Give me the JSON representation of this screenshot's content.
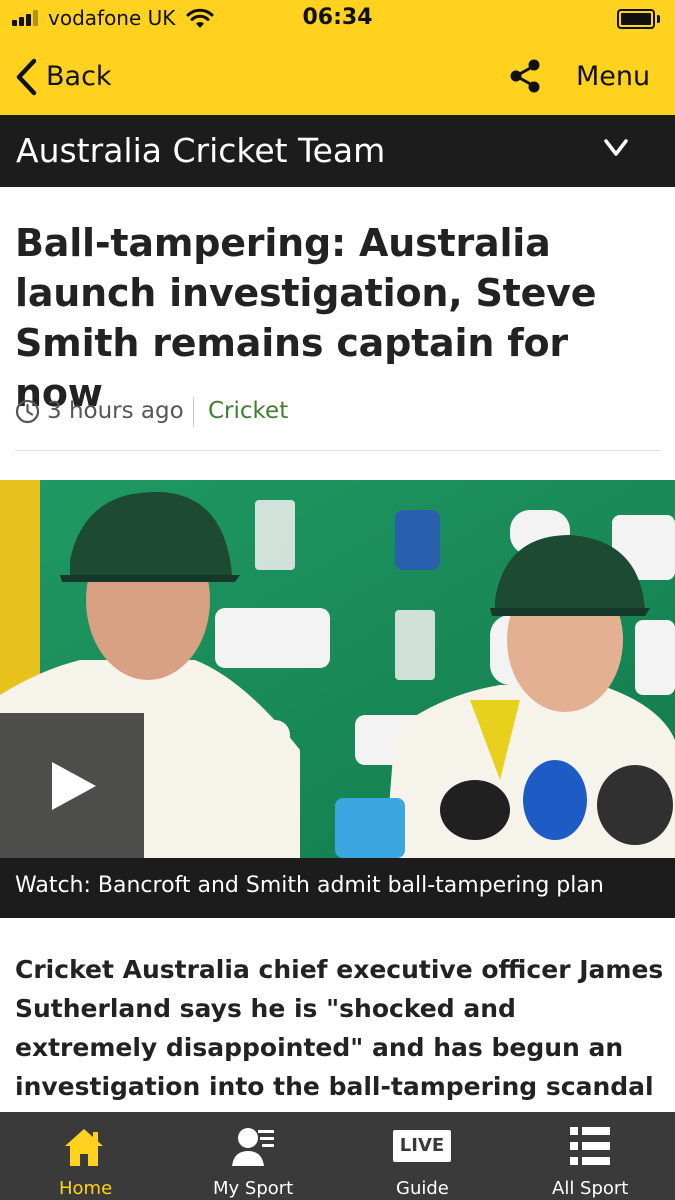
{
  "status_bar": {
    "carrier": "vodafone UK",
    "time": "06:34",
    "icons": [
      "signal-icon",
      "wifi-icon",
      "battery-icon"
    ]
  },
  "nav_bar": {
    "back_label": "Back",
    "menu_label": "Menu",
    "icons": [
      "back-chevron-icon",
      "share-icon"
    ]
  },
  "topic_bar": {
    "title": "Australia Cricket Team",
    "icon": "chevron-down-icon"
  },
  "article": {
    "headline": "Ball-tampering: Australia launch investigation, Steve Smith remains captain for now",
    "time_ago": "3 hours ago",
    "topic": "Cricket",
    "video_caption": "Watch: Bancroft and Smith admit ball-tampering plan",
    "intro": "Cricket Australia chief executive officer James Sutherland says he is \"shocked and extremely disappointed\" and has begun an investigation into the ball-tampering scandal involving the"
  },
  "tab_bar": {
    "tabs": [
      {
        "label": "Home",
        "icon": "home-icon",
        "active": true
      },
      {
        "label": "My Sport",
        "icon": "my-sport-icon",
        "active": false
      },
      {
        "label": "Guide",
        "icon": "live-guide-icon",
        "active": false
      },
      {
        "label": "All Sport",
        "icon": "all-sport-icon",
        "active": false
      }
    ]
  },
  "colors": {
    "brand_yellow": "#fed21f",
    "header_dark": "#1c1c1c",
    "topic_green": "#3f7e31",
    "tab_bar_bg": "#3a3a3a"
  }
}
